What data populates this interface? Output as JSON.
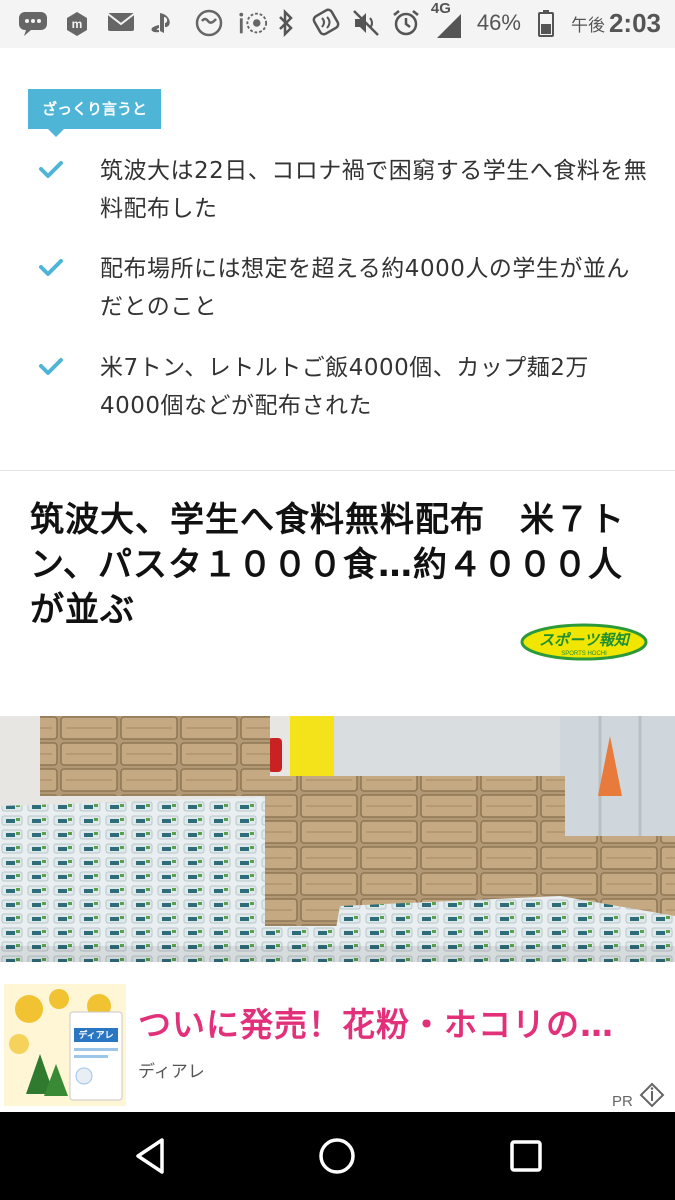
{
  "status_bar": {
    "left_icons": [
      "chat-bubble-icon",
      "mercari-icon",
      "au-mail-icon",
      "playstation-icon",
      "smile-app-icon",
      "instagram-like-icon"
    ],
    "right_icons": [
      "bluetooth-icon",
      "nfc-icon",
      "vibrate-mute-icon",
      "alarm-icon",
      "signal-4g-icon",
      "battery-icon"
    ],
    "network": "4G",
    "battery": "46%",
    "ampm": "午後",
    "time": "2:03"
  },
  "summary": {
    "tag": "ざっくり言うと",
    "bullets": [
      "筑波大は22日、コロナ禍で困窮する学生へ食料を無料配布した",
      "配布場所には想定を超える約4000人の学生が並んだとのこと",
      "米7トン、レトルトご飯4000個、カップ麺2万4000個などが配布された"
    ]
  },
  "article": {
    "headline": "筑波大、学生へ食料無料配布　米７トン、パスタ１０００食…約４０００人が並ぶ",
    "source_logo_text": "スポーツ報知",
    "source_logo_subtext": "SPORTS HOCHI"
  },
  "ad": {
    "thumb_label": "ディアレ",
    "title": "ついに発売！花粉・ホコリの…",
    "sponsor": "ディアレ",
    "pr": "PR"
  },
  "nav": {
    "buttons": [
      "back-icon",
      "home-icon",
      "recents-icon"
    ]
  },
  "colors": {
    "accent": "#4fb5d6",
    "ad_title": "#e2307a"
  }
}
